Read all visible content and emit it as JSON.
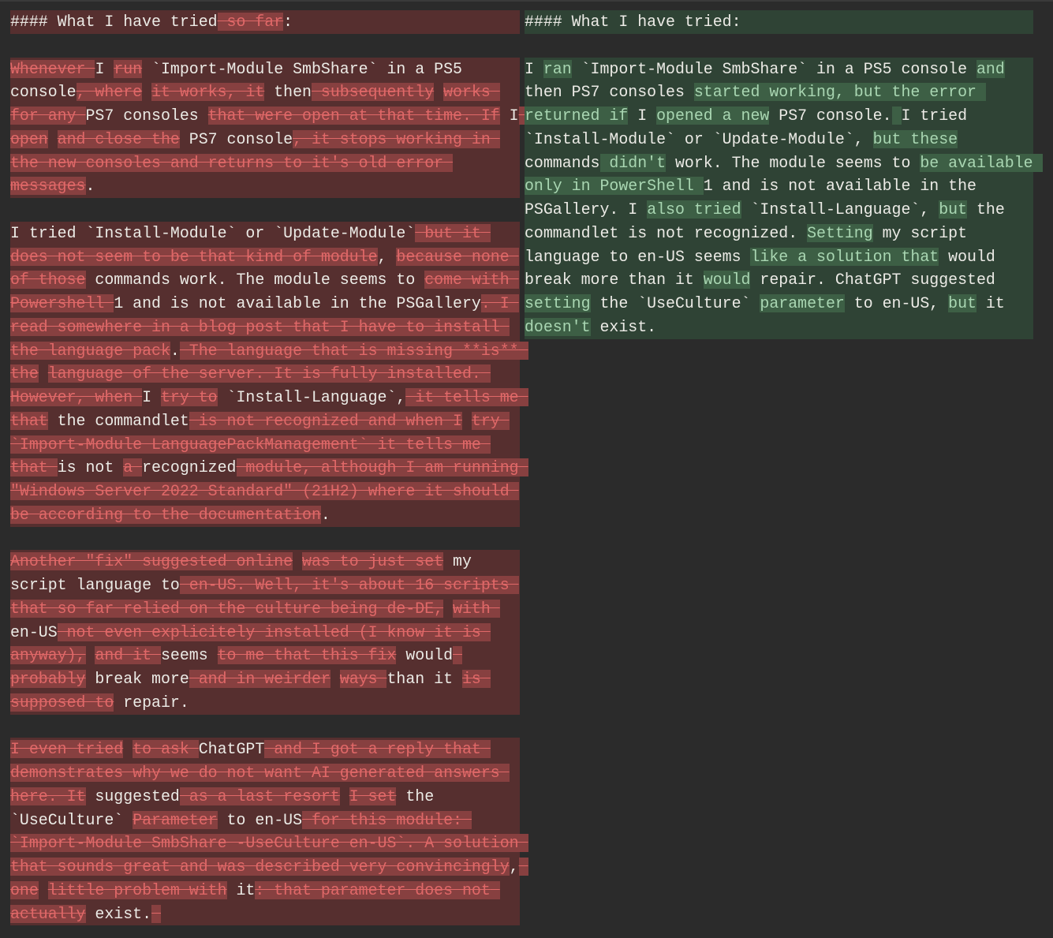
{
  "diff": {
    "colors": {
      "background": "#2b2b2b",
      "deleted_block": "#562f2f",
      "deleted_span": "#874040",
      "deleted_text": "#e06868",
      "inserted_block": "#2f4335",
      "inserted_span": "#3d5f45",
      "inserted_text": "#a9d6b2",
      "text": "#ecebe6"
    },
    "left": {
      "paragraphs": [
        [
          {
            "t": "#### What I have tried",
            "k": "e"
          },
          {
            "t": " so far",
            "k": "d"
          },
          {
            "t": ":",
            "k": "e"
          }
        ],
        [
          {
            "t": "Whenever ",
            "k": "d"
          },
          {
            "t": "I ",
            "k": "e"
          },
          {
            "t": "run",
            "k": "d"
          },
          {
            "t": " `Import-Module SmbShare` in a PS5 console",
            "k": "e"
          },
          {
            "t": ", where",
            "k": "d"
          },
          {
            "t": " ",
            "k": "e"
          },
          {
            "t": "it works, it",
            "k": "d"
          },
          {
            "t": " then",
            "k": "e"
          },
          {
            "t": " subsequently",
            "k": "d"
          },
          {
            "t": " ",
            "k": "e"
          },
          {
            "t": "works for any ",
            "k": "d"
          },
          {
            "t": "PS7 consoles ",
            "k": "e"
          },
          {
            "t": "that were open at that time. If",
            "k": "d"
          },
          {
            "t": " I",
            "k": "e"
          },
          {
            "t": " ",
            "k": "d"
          },
          {
            "t": "open",
            "k": "d"
          },
          {
            "t": " ",
            "k": "e"
          },
          {
            "t": "and close the",
            "k": "d"
          },
          {
            "t": " PS7 console",
            "k": "e"
          },
          {
            "t": ", it stops working in the new consoles and returns to it's old error messages",
            "k": "d"
          },
          {
            "t": ".",
            "k": "e"
          }
        ],
        [
          {
            "t": "I tried `Install-Module` or `Update-Module`",
            "k": "e"
          },
          {
            "t": " but it does not seem to be that kind of module",
            "k": "d"
          },
          {
            "t": ", ",
            "k": "e"
          },
          {
            "t": "because none of those",
            "k": "d"
          },
          {
            "t": " commands work. The module seems to ",
            "k": "e"
          },
          {
            "t": "come with Powershell ",
            "k": "d"
          },
          {
            "t": "1 and is not available in the PSGallery",
            "k": "e"
          },
          {
            "t": ". I read somewhere in a blog post that I have to install the language pack",
            "k": "d"
          },
          {
            "t": ".",
            "k": "e"
          },
          {
            "t": " The language that is missing **is** the",
            "k": "d"
          },
          {
            "t": " ",
            "k": "e"
          },
          {
            "t": "language of the server. It is fully installed. However, when ",
            "k": "d"
          },
          {
            "t": "I ",
            "k": "e"
          },
          {
            "t": "try to",
            "k": "d"
          },
          {
            "t": " `Install-Language`,",
            "k": "e"
          },
          {
            "t": " it tells me that",
            "k": "d"
          },
          {
            "t": " the commandlet",
            "k": "e"
          },
          {
            "t": " is not recognized and when I",
            "k": "d"
          },
          {
            "t": " ",
            "k": "e"
          },
          {
            "t": "try `Import-Module LanguagePackManagement` it tells me that ",
            "k": "d"
          },
          {
            "t": "is not ",
            "k": "e"
          },
          {
            "t": "a ",
            "k": "d"
          },
          {
            "t": "recognized",
            "k": "e"
          },
          {
            "t": " module, although I am running \"Windows Server 2022 Standard\" (21H2) where it should be according to the documentation",
            "k": "d"
          },
          {
            "t": ".",
            "k": "e"
          }
        ],
        [
          {
            "t": "Another \"fix\" suggested online",
            "k": "d"
          },
          {
            "t": " ",
            "k": "e"
          },
          {
            "t": "was to just set",
            "k": "d"
          },
          {
            "t": " my script language to",
            "k": "e"
          },
          {
            "t": " en-US. Well, it's about 16 scripts that so far relied on the culture being de-DE,",
            "k": "d"
          },
          {
            "t": " ",
            "k": "e"
          },
          {
            "t": "with ",
            "k": "d"
          },
          {
            "t": "en-US",
            "k": "e"
          },
          {
            "t": " not even explicitely installed (I know it is anyway),",
            "k": "d"
          },
          {
            "t": " ",
            "k": "e"
          },
          {
            "t": "and it ",
            "k": "d"
          },
          {
            "t": "seems ",
            "k": "e"
          },
          {
            "t": "to me that this fix",
            "k": "d"
          },
          {
            "t": " would",
            "k": "e"
          },
          {
            "t": " probably",
            "k": "d"
          },
          {
            "t": " break more",
            "k": "e"
          },
          {
            "t": " and in weirder",
            "k": "d"
          },
          {
            "t": " ",
            "k": "e"
          },
          {
            "t": "ways ",
            "k": "d"
          },
          {
            "t": "than it ",
            "k": "e"
          },
          {
            "t": "is supposed to",
            "k": "d"
          },
          {
            "t": " repair.",
            "k": "e"
          }
        ],
        [
          {
            "t": "I even tried",
            "k": "d"
          },
          {
            "t": " ",
            "k": "e"
          },
          {
            "t": "to ask ",
            "k": "d"
          },
          {
            "t": "ChatGPT",
            "k": "e"
          },
          {
            "t": " and I got a reply that demonstrates why we do not want AI generated answers here. It",
            "k": "d"
          },
          {
            "t": " suggested",
            "k": "e"
          },
          {
            "t": " as a last resort",
            "k": "d"
          },
          {
            "t": " ",
            "k": "e"
          },
          {
            "t": "I set",
            "k": "d"
          },
          {
            "t": " the `UseCulture` ",
            "k": "e"
          },
          {
            "t": "Parameter",
            "k": "d"
          },
          {
            "t": " to en-US",
            "k": "e"
          },
          {
            "t": " for this module: `Import-Module SmbShare -UseCulture en-US`. A solution that sounds great and was described very convincingly",
            "k": "d"
          },
          {
            "t": ",",
            "k": "e"
          },
          {
            "t": " one",
            "k": "d"
          },
          {
            "t": " ",
            "k": "e"
          },
          {
            "t": "little problem with",
            "k": "d"
          },
          {
            "t": " it",
            "k": "e"
          },
          {
            "t": ": that parameter does not actually",
            "k": "d"
          },
          {
            "t": " exist.",
            "k": "e"
          },
          {
            "t": " ",
            "k": "d"
          }
        ]
      ]
    },
    "right": {
      "paragraphs": [
        [
          {
            "t": "#### What I have tried:",
            "k": "e"
          }
        ],
        [
          {
            "t": "I ",
            "k": "e"
          },
          {
            "t": "ran",
            "k": "i"
          },
          {
            "t": " `Import-Module SmbShare` in a PS5 console ",
            "k": "e"
          },
          {
            "t": "and",
            "k": "i"
          },
          {
            "t": " then PS7 consoles ",
            "k": "e"
          },
          {
            "t": "started working, but the error returned if",
            "k": "i"
          },
          {
            "t": " I ",
            "k": "e"
          },
          {
            "t": "opened a new",
            "k": "i"
          },
          {
            "t": " PS7 console.",
            "k": "e"
          },
          {
            "t": " ",
            "k": "i"
          },
          {
            "t": "I tried `Install-Module` or `Update-Module`, ",
            "k": "e"
          },
          {
            "t": "but these",
            "k": "i"
          },
          {
            "t": " commands",
            "k": "e"
          },
          {
            "t": " didn't",
            "k": "i"
          },
          {
            "t": " work. The module seems to ",
            "k": "e"
          },
          {
            "t": "be available only in PowerShell ",
            "k": "i"
          },
          {
            "t": "1 and is not available in the PSGallery. I ",
            "k": "e"
          },
          {
            "t": "also tried",
            "k": "i"
          },
          {
            "t": " `Install-Language`, ",
            "k": "e"
          },
          {
            "t": "but",
            "k": "i"
          },
          {
            "t": " the commandlet is not recognized. ",
            "k": "e"
          },
          {
            "t": "Setting",
            "k": "i"
          },
          {
            "t": " my script language to en-US seems ",
            "k": "e"
          },
          {
            "t": "like a solution that",
            "k": "i"
          },
          {
            "t": " would break more than it ",
            "k": "e"
          },
          {
            "t": "would",
            "k": "i"
          },
          {
            "t": " repair. ChatGPT suggested ",
            "k": "e"
          },
          {
            "t": "setting",
            "k": "i"
          },
          {
            "t": " the `UseCulture` ",
            "k": "e"
          },
          {
            "t": "parameter",
            "k": "i"
          },
          {
            "t": " to en-US, ",
            "k": "e"
          },
          {
            "t": "but",
            "k": "i"
          },
          {
            "t": " it ",
            "k": "e"
          },
          {
            "t": "doesn't",
            "k": "i"
          },
          {
            "t": " exist.",
            "k": "e"
          }
        ]
      ]
    }
  }
}
